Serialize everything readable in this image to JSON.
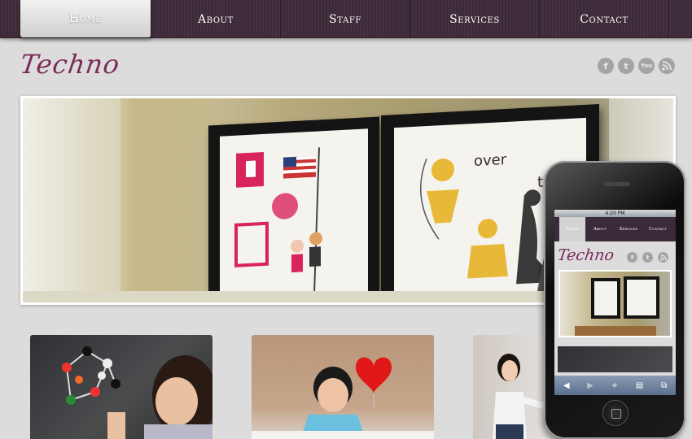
{
  "nav": {
    "items": [
      "Home",
      "About",
      "Staff",
      "Services",
      "Contact"
    ],
    "active": "Home"
  },
  "brand": {
    "logo": "Techno",
    "accent": "#7b2a5a",
    "nav_bg": "#3b2a37"
  },
  "social": [
    {
      "icon": "facebook-icon",
      "glyph": "f"
    },
    {
      "icon": "twitter-icon",
      "glyph": "t"
    },
    {
      "icon": "youtube-icon",
      "glyph": "You"
    },
    {
      "icon": "rss-icon",
      "glyph": ")"
    }
  ],
  "banner": {
    "poster_left_text": "",
    "poster_right_words": [
      "over",
      "top"
    ]
  },
  "phone": {
    "time": "4:20 PM",
    "nav_items": [
      "Home",
      "About",
      "Services",
      "Contact"
    ],
    "logo": "Techno",
    "toolbar_icons": [
      "◀",
      "▶",
      "+",
      "▤",
      "⧉"
    ]
  }
}
